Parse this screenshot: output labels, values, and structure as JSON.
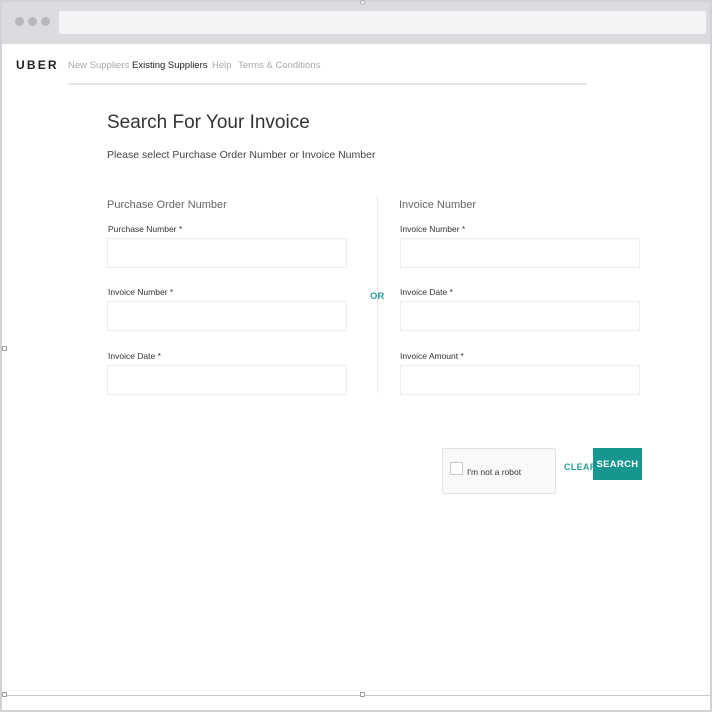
{
  "nav": {
    "logo": "UBER",
    "links": [
      {
        "label": "New Suppliers",
        "active": false
      },
      {
        "label": "Existing Suppliers",
        "active": true
      },
      {
        "label": "Help",
        "active": false
      },
      {
        "label": "Terms & Conditions",
        "active": false
      }
    ]
  },
  "page": {
    "title": "Search For Your Invoice",
    "subtitle": "Please select Purchase Order Number or Invoice Number"
  },
  "left_section": {
    "heading": "Purchase Order Number",
    "fields": [
      {
        "label": "Purchase Number *",
        "value": ""
      },
      {
        "label": "Invoice Number *",
        "value": ""
      },
      {
        "label": "Invoice Date *",
        "value": ""
      }
    ]
  },
  "separator": {
    "label": "OR"
  },
  "right_section": {
    "heading": "Invoice Number",
    "fields": [
      {
        "label": "Invoice Number *",
        "value": ""
      },
      {
        "label": "Invoice Date *",
        "value": ""
      },
      {
        "label": "Invoice Amount *",
        "value": ""
      }
    ]
  },
  "captcha": {
    "label": "I'm not a robot"
  },
  "actions": {
    "clear_label": "CLEAR",
    "search_label": "SEARCH"
  },
  "colors": {
    "accent": "#16968f",
    "text": "#333333",
    "muted": "#a9a9ad"
  }
}
